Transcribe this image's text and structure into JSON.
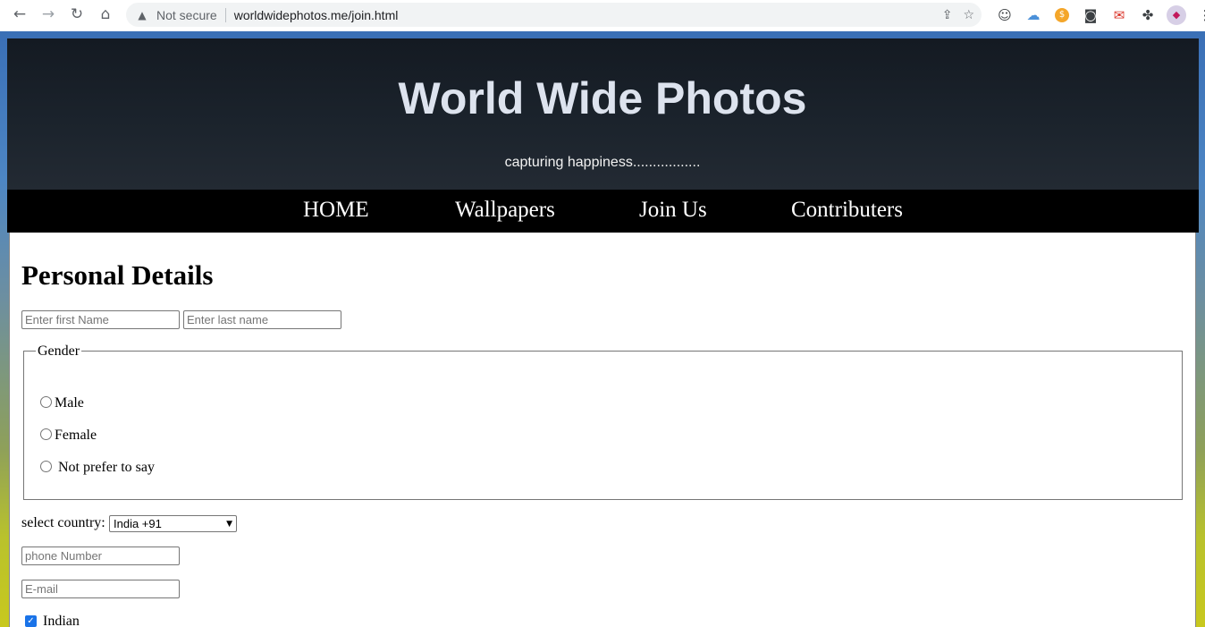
{
  "browser": {
    "security_label": "Not secure",
    "url": "worldwidephotos.me/join.html"
  },
  "site": {
    "title": "World Wide Photos",
    "tagline": "capturing happiness................."
  },
  "menu": {
    "items": [
      "HOME",
      "Wallpapers",
      "Join Us",
      "Contributers"
    ]
  },
  "form": {
    "heading": "Personal Details",
    "first_name_placeholder": "Enter first Name",
    "last_name_placeholder": "Enter last name",
    "gender": {
      "legend": "Gender",
      "options": [
        "Male",
        "Female",
        "Not prefer to say"
      ]
    },
    "country_label": "select country:",
    "country_selected": "India +91",
    "phone_placeholder": "phone Number",
    "email_placeholder": "E-mail",
    "nationality_checkbox": {
      "label": "Indian",
      "checked": true
    }
  }
}
